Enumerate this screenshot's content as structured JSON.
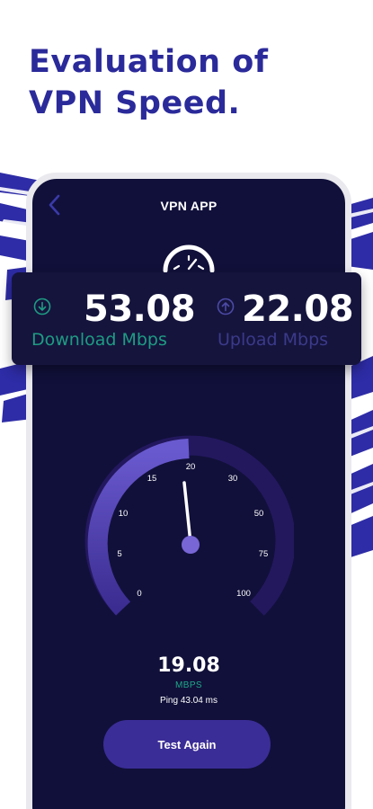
{
  "headline": {
    "line1": "Evaluation of",
    "line2": "VPN Speed."
  },
  "app": {
    "title": "VPN APP"
  },
  "download": {
    "value": "53.08",
    "label": "Download Mbps"
  },
  "upload": {
    "value": "22.08",
    "label": "Upload Mbps"
  },
  "gauge": {
    "ticks": [
      "0",
      "5",
      "10",
      "15",
      "20",
      "30",
      "50",
      "75",
      "100"
    ],
    "needle_value": 19.08
  },
  "result": {
    "speed": "19.08",
    "unit": "MBPS",
    "ping": "Ping 43.04 ms"
  },
  "test_again_label": "Test Again",
  "colors": {
    "brand": "#2b2a9a",
    "screen_bg": "#11103a",
    "download_accent": "#1e9c83",
    "upload_accent": "#3b3a8a",
    "button": "#3b2d97"
  },
  "icons": {
    "back": "chevron-left-icon",
    "speedometer": "speedometer-icon",
    "download": "download-arrow-icon",
    "upload": "upload-arrow-icon"
  }
}
